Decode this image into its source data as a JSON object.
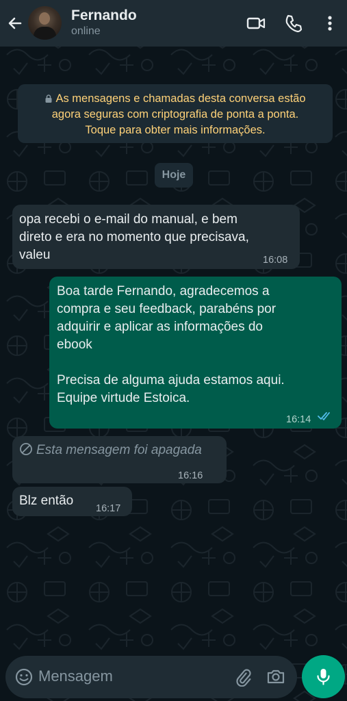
{
  "header": {
    "contact_name": "Fernando",
    "status": "online",
    "icons": [
      "back-arrow-icon",
      "video-call-icon",
      "phone-icon",
      "more-vert-icon"
    ]
  },
  "encryption_notice": {
    "line1": "As mensagens e chamadas desta conversa estão",
    "line2": "agora seguras com criptografia de ponta a ponta.",
    "line3": "Toque para obter mais informações."
  },
  "date_chip": "Hoje",
  "messages": [
    {
      "direction": "incoming",
      "lines": [
        "opa recebi o e-mail do manual, e bem",
        "direto e era no momento que precisava,",
        "valeu"
      ],
      "time": "16:08"
    },
    {
      "direction": "outgoing",
      "lines": [
        "Boa tarde Fernando, agradecemos a",
        "compra e seu feedback, parabéns por",
        "adquirir e aplicar as informações do",
        "ebook",
        "",
        "Precisa de alguma ajuda estamos aqui.",
        "Equipe virtude Estoica."
      ],
      "time": "16:14",
      "ticks": "read"
    },
    {
      "direction": "incoming",
      "deleted": true,
      "text": "Esta mensagem foi apagada",
      "time": "16:16"
    },
    {
      "direction": "incoming",
      "text": "Blz então",
      "time": "16:17"
    }
  ],
  "composer": {
    "placeholder": "Mensagem",
    "icons": [
      "emoji-icon",
      "attach-icon",
      "camera-icon",
      "mic-icon"
    ]
  },
  "colors": {
    "background": "#0b141a",
    "header": "#1f2c34",
    "incoming_bubble": "#202c33",
    "outgoing_bubble": "#005c4b",
    "notice_text": "#ffd279",
    "read_ticks": "#53bdeb",
    "mic_button": "#00a884"
  }
}
